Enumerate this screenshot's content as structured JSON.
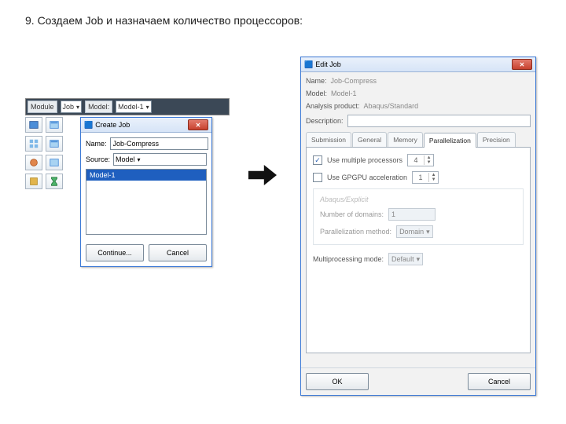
{
  "heading": "9. Создаем Job и назначаем количество процессоров:",
  "module_bar": {
    "module_label": "Module",
    "module_value": "Job",
    "model_label": "Model:",
    "model_value": "Model-1"
  },
  "create_job": {
    "title": "Create Job",
    "close_symbol": "✕",
    "name_label": "Name:",
    "name_value": "Job-Compress",
    "source_label": "Source:",
    "source_value": "Model",
    "list_selected": "Model-1",
    "continue_label": "Continue...",
    "cancel_label": "Cancel"
  },
  "edit_job": {
    "title": "Edit Job",
    "close_symbol": "✕",
    "name_label": "Name:",
    "name_value": "Job-Compress",
    "model_label": "Model:",
    "model_value": "Model-1",
    "product_label": "Analysis product:",
    "product_value": "Abaqus/Standard",
    "description_label": "Description:",
    "description_value": "",
    "tabs": {
      "submission": "Submission",
      "general": "General",
      "memory": "Memory",
      "parallelization": "Parallelization",
      "precision": "Precision"
    },
    "parallel_panel": {
      "use_multi_label": "Use multiple processors",
      "use_multi_value": "4",
      "use_gpu_label": "Use GPGPU acceleration",
      "use_gpu_value": "1",
      "explicit_heading": "Abaqus/Explicit",
      "num_domains_label": "Number of domains:",
      "num_domains_value": "1",
      "par_method_label": "Parallelization method:",
      "par_method_value": "Domain",
      "mp_mode_label": "Multiprocessing mode:",
      "mp_mode_value": "Default"
    },
    "ok_label": "OK",
    "cancel_label": "Cancel"
  }
}
